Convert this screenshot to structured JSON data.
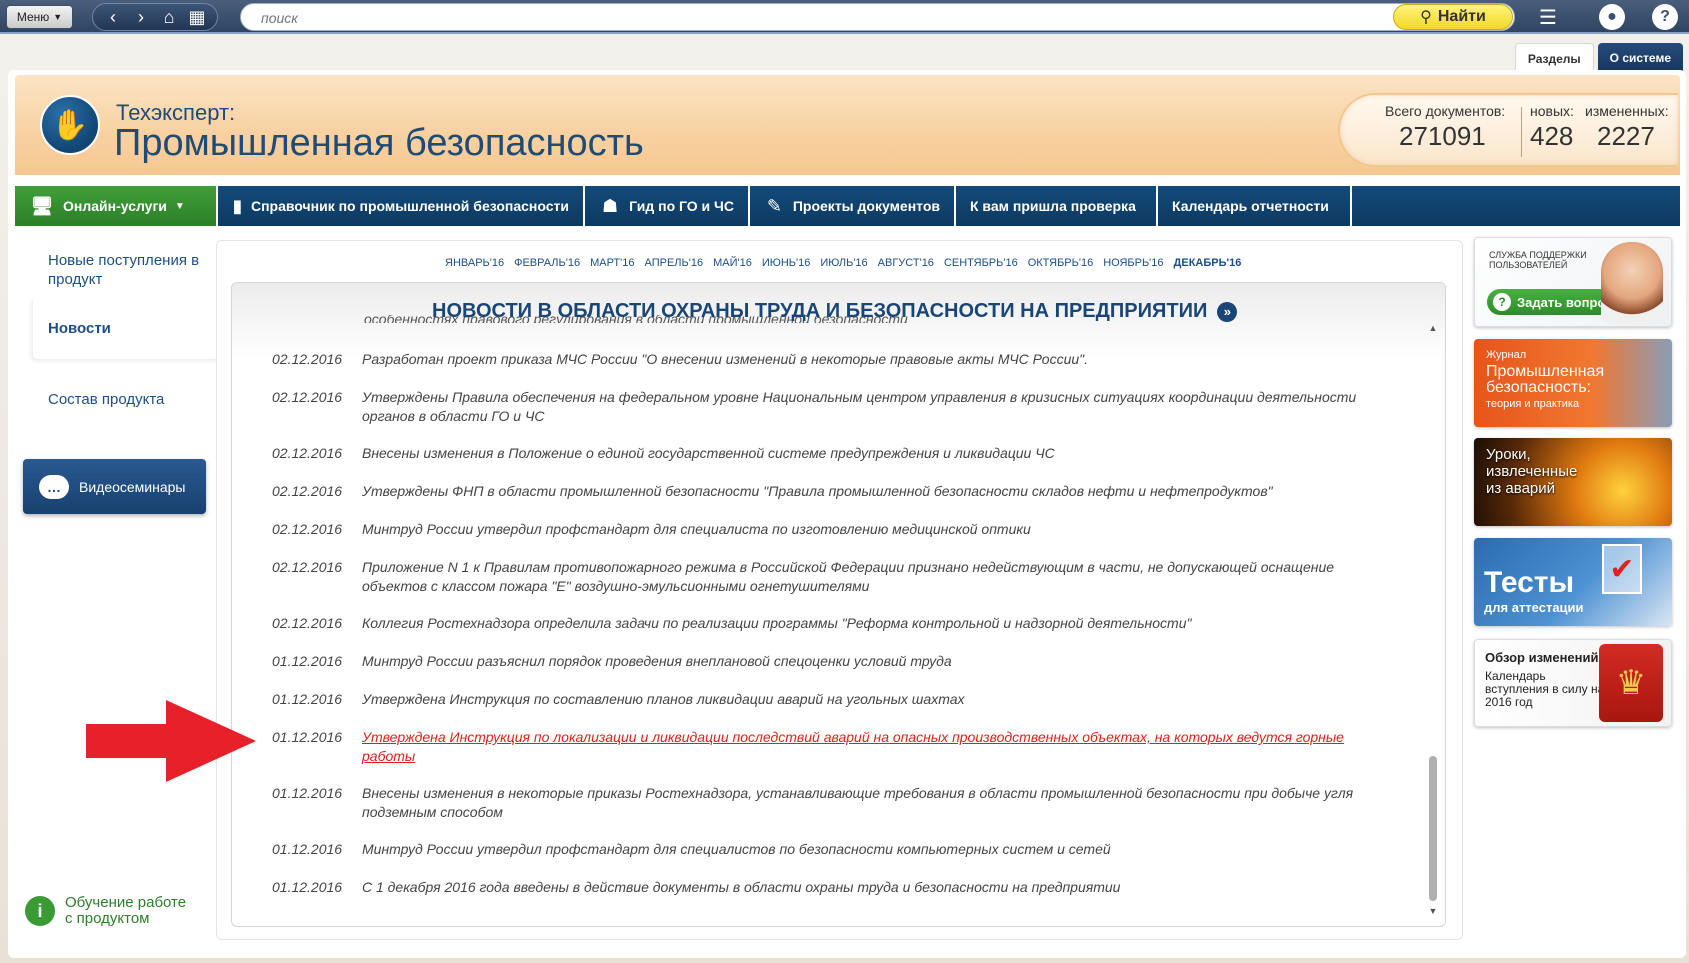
{
  "topbar": {
    "menu_label": "Меню",
    "search_placeholder": "поиск",
    "search_button": "Найти"
  },
  "section_tabs": [
    "Разделы",
    "О системе"
  ],
  "header": {
    "brand_sub": "Техэксперт:",
    "brand_title": "Промышленная безопасность",
    "stats": {
      "total_label": "Всего документов:",
      "total_value": "271091",
      "new_label": "новых:",
      "new_value": "428",
      "changed_label": "измененных:",
      "changed_value": "2227"
    }
  },
  "mainnav": [
    {
      "label": "Онлайн-услуги",
      "icon": "monitor-icon"
    },
    {
      "label": "Справочник по промышленной безопасности",
      "icon": "book-icon"
    },
    {
      "label": "Гид по ГО и ЧС",
      "icon": "person-icon"
    },
    {
      "label": "Проекты документов",
      "icon": "edit-document-icon"
    },
    {
      "label": "К вам пришла проверка",
      "icon": ""
    },
    {
      "label": "Календарь отчетности",
      "icon": ""
    }
  ],
  "sidebar": {
    "new_items": "Новые поступления в продукт",
    "news": "Новости",
    "composition": "Состав продукта",
    "video": "Видеосеминары",
    "help": "Обучение работе с продуктом"
  },
  "months": [
    "ЯНВАРЬ'16",
    "ФЕВРАЛЬ'16",
    "МАРТ'16",
    "АПРЕЛЬ'16",
    "МАЙ'16",
    "ИЮНЬ'16",
    "ИЮЛЬ'16",
    "АВГУСТ'16",
    "СЕНТЯБРЬ'16",
    "ОКТЯБРЬ'16",
    "НОЯБРЬ'16",
    "ДЕКАБРЬ'16"
  ],
  "news_title": "НОВОСТИ В ОБЛАСТИ ОХРАНЫ ТРУДА И БЕЗОПАСНОСТИ НА ПРЕДПРИЯТИИ",
  "news_cutoff": "особенностях правового регулирования в области промышленной безопасности",
  "news": [
    {
      "date": "02.12.2016",
      "text": "Разработан проект приказа МЧС России \"О внесении изменений в некоторые правовые акты МЧС России\"."
    },
    {
      "date": "02.12.2016",
      "text": "Утверждены Правила обеспечения на федеральном уровне Национальным центром управления в кризисных ситуациях координации деятельности органов в области ГО и ЧС"
    },
    {
      "date": "02.12.2016",
      "text": "Внесены изменения в Положение о единой государственной системе предупреждения и ликвидации ЧС"
    },
    {
      "date": "02.12.2016",
      "text": "Утверждены ФНП в области промышленной безопасности \"Правила промышленной безопасности складов нефти и нефтепродуктов\""
    },
    {
      "date": "02.12.2016",
      "text": "Минтруд России утвердил профстандарт для специалиста по изготовлению медицинской оптики"
    },
    {
      "date": "02.12.2016",
      "text": "Приложение N 1 к Правилам противопожарного режима в Российской Федерации признано недействующим в части, не допускающей оснащение объектов с классом пожара \"Е\" воздушно-эмульсионными огнетушителями"
    },
    {
      "date": "02.12.2016",
      "text": "Коллегия Ростехнадзора определила задачи по реализации программы \"Реформа контрольной и надзорной деятельности\""
    },
    {
      "date": "01.12.2016",
      "text": "Минтруд России разъяснил порядок проведения внеплановой спецоценки условий труда"
    },
    {
      "date": "01.12.2016",
      "text": "Утверждена Инструкция по составлению планов ликвидации аварий на угольных шахтах"
    },
    {
      "date": "01.12.2016",
      "text": "Утверждена Инструкция по локализации и ликвидации последствий аварий на опасных производственных объектах, на которых ведутся горные работы"
    },
    {
      "date": "01.12.2016",
      "text": "Внесены изменения в некоторые приказы Ростехнадзора, устанавливающие требования в области промышленной безопасности при добыче угля подземным способом"
    },
    {
      "date": "01.12.2016",
      "text": "Минтруд России утвердил профстандарт для специалистов по безопасности компьютерных систем и сетей"
    },
    {
      "date": "01.12.2016",
      "text": "С 1 декабря 2016 года введены в действие документы в области охраны труда и безопасности на предприятии"
    }
  ],
  "banners": {
    "support_small": "Служба поддержки пользователей",
    "support_button": "Задать вопрос",
    "journal_1": "Журнал",
    "journal_2": "Промышленная безопасность:",
    "journal_3": "теория и практика",
    "lessons": "Уроки, извлеченные из аварий",
    "tests_1": "Тесты",
    "tests_2": "для аттестации",
    "review_1": "Обзор изменений",
    "review_2": "Календарь вступления в силу на 2016 год"
  },
  "colors": {
    "nav_blue": "#134a79",
    "nav_green": "#3f9f3a",
    "highlight_red": "#e02020",
    "link_blue": "#1d4f86"
  }
}
